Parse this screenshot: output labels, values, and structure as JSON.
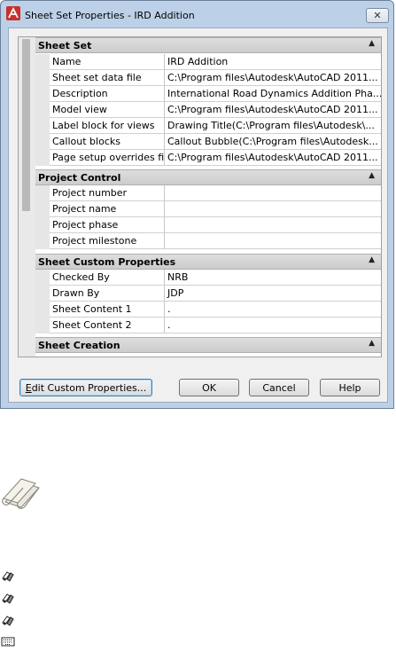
{
  "window": {
    "title": "Sheet Set Properties - IRD Addition",
    "close_glyph": "✕"
  },
  "categories": [
    {
      "label": "Sheet Set",
      "rows": [
        {
          "name": "Name",
          "value": "IRD Addition"
        },
        {
          "name": "Sheet set data file",
          "value": "C:\\Program files\\Autodesk\\AutoCAD 2011..."
        },
        {
          "name": "Description",
          "value": "International Road Dynamics Addition Pha..."
        },
        {
          "name": "Model view",
          "value": "C:\\Program files\\Autodesk\\AutoCAD 2011..."
        },
        {
          "name": "Label block for views",
          "value": "Drawing Title(C:\\Program files\\Autodesk\\..."
        },
        {
          "name": "Callout blocks",
          "value": "Callout Bubble(C:\\Program files\\Autodesk..."
        },
        {
          "name": "Page setup overrides file",
          "value": "C:\\Program files\\Autodesk\\AutoCAD 2011..."
        }
      ]
    },
    {
      "label": "Project Control",
      "rows": [
        {
          "name": "Project number",
          "value": ""
        },
        {
          "name": "Project name",
          "value": ""
        },
        {
          "name": "Project phase",
          "value": ""
        },
        {
          "name": "Project milestone",
          "value": ""
        }
      ]
    },
    {
      "label": "Sheet Custom Properties",
      "rows": [
        {
          "name": "Checked By",
          "value": "NRB"
        },
        {
          "name": "Drawn By",
          "value": "JDP"
        },
        {
          "name": "Sheet Content 1",
          "value": "."
        },
        {
          "name": "Sheet Content 2",
          "value": "."
        }
      ]
    },
    {
      "label": "Sheet Creation",
      "rows": []
    }
  ],
  "collapse_glyph": "▲",
  "buttons": {
    "edit_custom_mnemonic": "E",
    "edit_custom_rest": "dit Custom Properties...",
    "ok": "OK",
    "cancel": "Cancel",
    "help": "Help"
  },
  "icons": {
    "app": "autocad-logo-icon",
    "sheetset": "sheet-set-icon",
    "small": [
      "named-object-icon",
      "named-object-icon",
      "named-object-icon",
      "keyboard-icon"
    ]
  }
}
